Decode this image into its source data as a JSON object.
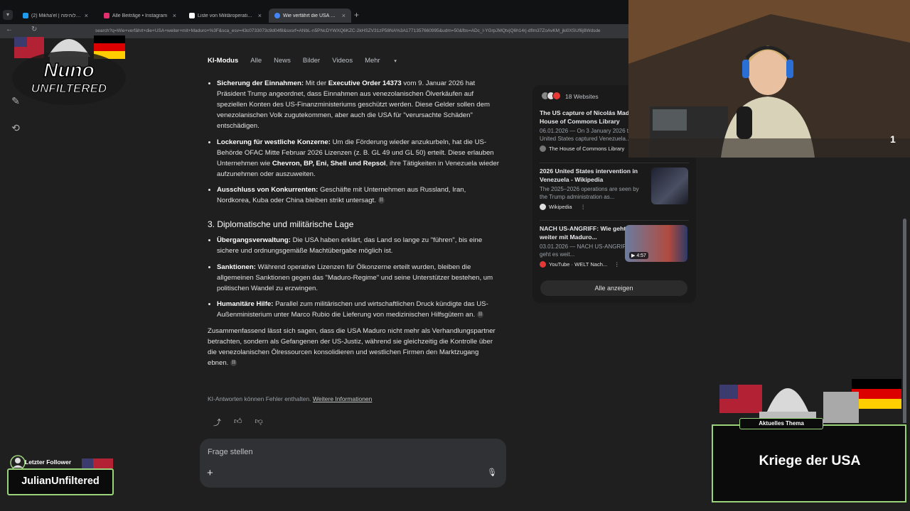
{
  "browser": {
    "tabs": [
      {
        "title": "(2) Mikha'el | דרך לוהימה",
        "favicon_color": "#1d9bf0",
        "active": false
      },
      {
        "title": "Alle Beiträge • Instagram",
        "favicon_color": "#e1306c",
        "active": false
      },
      {
        "title": "Liste von Militäroperationen de",
        "favicon_color": "#ffffff",
        "active": false
      },
      {
        "title": "Wie verfährt die USA weiter mit",
        "favicon_color": "#4285f4",
        "active": true
      }
    ],
    "url": "search?q=Wie+verfährt+die+USA+weiter+mit+Maduro+%3F&sca_esv=43c0733073c9d04f8&sxsrf=ANbL-n5PNcDYWXQ6KZC-2kHSZV31zP58NA%3A1771357660995&udm=50&fbs=ADc_l-YGrpJMQtvjQ6h14rj-dflm37ZoAvKM_jki0XSUf6j8Wdsde"
  },
  "search_nav": [
    "KI-Modus",
    "Alle",
    "News",
    "Bilder",
    "Videos",
    "Mehr"
  ],
  "search_nav_more_suffix": "▾",
  "answer": {
    "items_a": [
      {
        "bold": "Sicherung der Einnahmen:",
        "pre": " Mit der ",
        "bold2": "Executive Order 14373",
        "post": " vom 9. Januar 2026 hat Präsident Trump angeordnet, dass Einnahmen aus venezolanischen Ölverkäufen auf speziellen Konten des US-Finanzministeriums geschützt werden. Diese Gelder sollen dem venezolanischen Volk zugutekommen, aber auch die USA für \"verursachte Schäden\" entschädigen."
      },
      {
        "bold": "Lockerung für westliche Konzerne:",
        "pre": " Um die Förderung wieder anzukurbeln, hat die US-Behörde OFAC Mitte Februar 2026 Lizenzen (z. B. GL 49 und GL 50) erteilt. Diese erlauben Unternehmen wie ",
        "bold2": "Chevron, BP, Eni, Shell und Repsol",
        "post": ", ihre Tätigkeiten in Venezuela wieder aufzunehmen oder auszuweiten."
      },
      {
        "bold": "Ausschluss von Konkurrenten:",
        "pre": " Geschäfte mit Unternehmen aus Russland, Iran, Nordkorea, Kuba oder China bleiben strikt untersagt.",
        "bold2": "",
        "post": ""
      }
    ],
    "heading": "3. Diplomatische und militärische Lage",
    "items_b": [
      {
        "bold": "Übergangsverwaltung:",
        "text": " Die USA haben erklärt, das Land so lange zu \"führen\", bis eine sichere und ordnungsgemäße Machtübergabe möglich ist."
      },
      {
        "bold": "Sanktionen:",
        "text": " Während operative Lizenzen für Ölkonzerne erteilt wurden, bleiben die allgemeinen Sanktionen gegen das \"Maduro-Regime\" und seine Unterstützer bestehen, um politischen Wandel zu erzwingen."
      },
      {
        "bold": "Humanitäre Hilfe:",
        "text": " Parallel zum militärischen und wirtschaftlichen Druck kündigte das US-Außenministerium unter Marco Rubio die Lieferung von medizinischen Hilfsgütern an."
      }
    ],
    "summary": "Zusammenfassend lässt sich sagen, dass die USA Maduro nicht mehr als Verhandlungspartner betrachten, sondern als Gefangenen der US-Justiz, während sie gleichzeitig die Kontrolle über die venezolanischen Ölressourcen konsolidieren und westlichen Firmen den Marktzugang ebnen.",
    "disclaimer": "KI-Antworten können Fehler enthalten.",
    "disclaimer_link": "Weitere Informationen"
  },
  "ask": {
    "placeholder": "Frage stellen"
  },
  "sources": {
    "count_label": "18 Websites",
    "items": [
      {
        "title": "The US capture of Nicolás Maduro - House of Commons Library",
        "snippet": "06.01.2026 — On 3 January 2026 the United States captured Venezuela...",
        "origin": "The House of Commons Library",
        "thumb_color": "#6b6f72"
      },
      {
        "title": "2026 United States intervention in Venezuela - Wikipedia",
        "snippet": "The 2025–2026 operations are seen by the Trump administration as...",
        "origin": "Wikipedia",
        "thumb_color": "#2a2d3a"
      },
      {
        "title": "NACH US-ANGRIFF: Wie geht es weiter mit Maduro...",
        "snippet": "03.01.2026 — NACH US-ANGRIFF: Wie geht es weit...",
        "origin": "YouTube · WELT Nach...",
        "thumb_color": "#4a5a7a",
        "duration": "4:57"
      }
    ],
    "show_all": "Alle anzeigen"
  },
  "overlay": {
    "logo_line1": "Nuno",
    "logo_line2": "UNFILTERED",
    "follower_label": "Letzter Follower",
    "follower_name": "JulianUnfiltered",
    "topic_label": "Aktuelles Thema",
    "topic_text": "Kriege der USA",
    "cam_counter": "1"
  },
  "colors": {
    "accent_green": "#9bd37a",
    "bg": "#1f1f1f"
  }
}
